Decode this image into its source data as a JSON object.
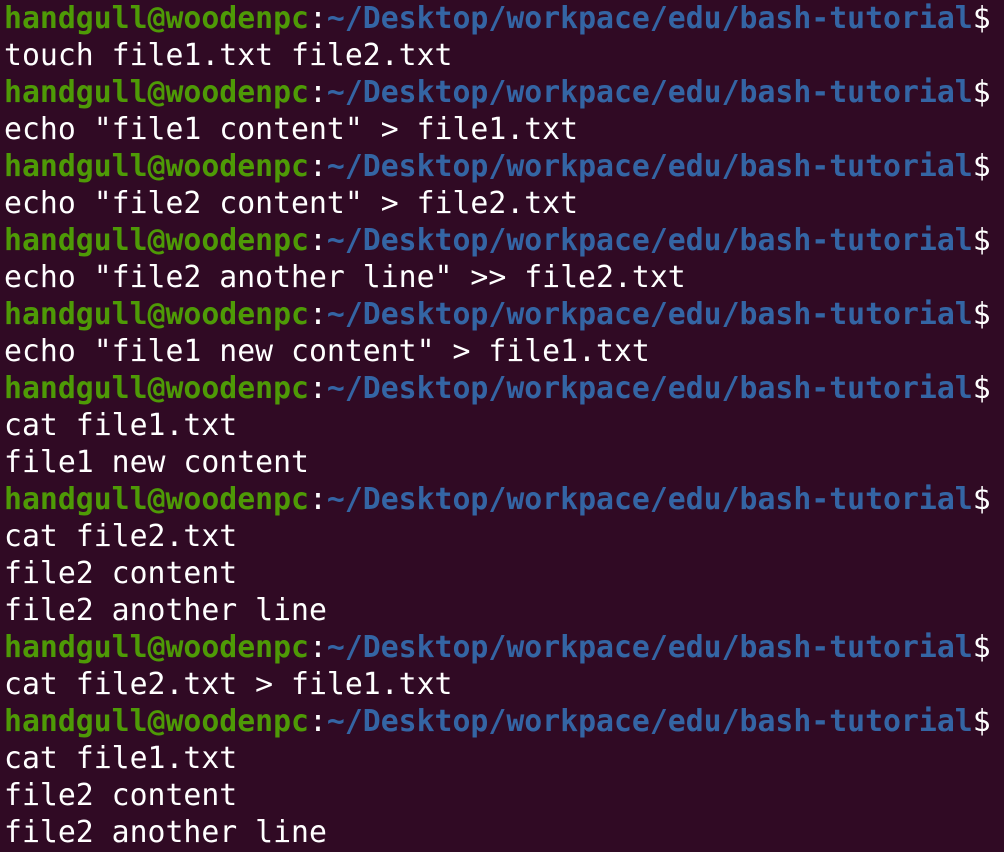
{
  "terminal": {
    "user_host": "handgull@woodenpc",
    "separator": ":",
    "path": "~/Desktop/workpace/edu/bash-tutorial",
    "prompt_symbol": "$",
    "colors": {
      "background": "#300a24",
      "user_host": "#4e9a06",
      "path": "#3465a4",
      "text": "#ffffff"
    },
    "blocks": [
      {
        "command": "touch file1.txt file2.txt",
        "output": []
      },
      {
        "command": "echo \"file1 content\" > file1.txt",
        "output": []
      },
      {
        "command": "echo \"file2 content\" > file2.txt",
        "output": []
      },
      {
        "command": "echo \"file2 another line\" >> file2.txt",
        "output": []
      },
      {
        "command": "echo \"file1 new content\" > file1.txt",
        "output": []
      },
      {
        "command": "cat file1.txt",
        "output": [
          "file1 new content"
        ]
      },
      {
        "command": "cat file2.txt",
        "output": [
          "file2 content",
          "file2 another line"
        ]
      },
      {
        "command": "cat file2.txt > file1.txt",
        "output": []
      },
      {
        "command": "cat file1.txt",
        "output": [
          "file2 content",
          "file2 another line"
        ]
      }
    ]
  }
}
